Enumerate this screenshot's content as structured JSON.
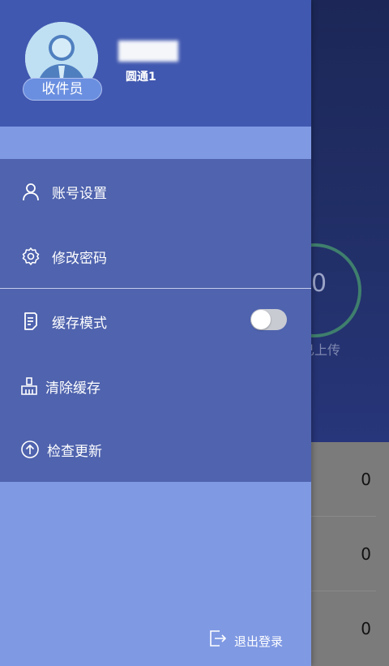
{
  "background": {
    "ring_value": "0",
    "ring_caption": "已上传",
    "list_values": [
      "0",
      "0",
      "0"
    ]
  },
  "profile": {
    "role_badge": "收件员",
    "company": "圆通1"
  },
  "menu": {
    "account_settings": "账号设置",
    "change_password": "修改密码",
    "cache_mode": "缓存模式",
    "cache_mode_on": false,
    "clear_cache": "清除缓存",
    "check_update": "检查更新"
  },
  "footer": {
    "logout": "退出登录"
  },
  "colors": {
    "header": "#4158b0",
    "menu_bg": "#4f63ae",
    "drawer_bg": "#7f99e3",
    "badge": "#6a8fe0"
  },
  "icons": {
    "account": "person-outline-icon",
    "password": "gear-icon",
    "cache": "document-icon",
    "clear": "broom-icon",
    "update": "arrow-up-circle-icon",
    "logout": "exit-icon"
  }
}
